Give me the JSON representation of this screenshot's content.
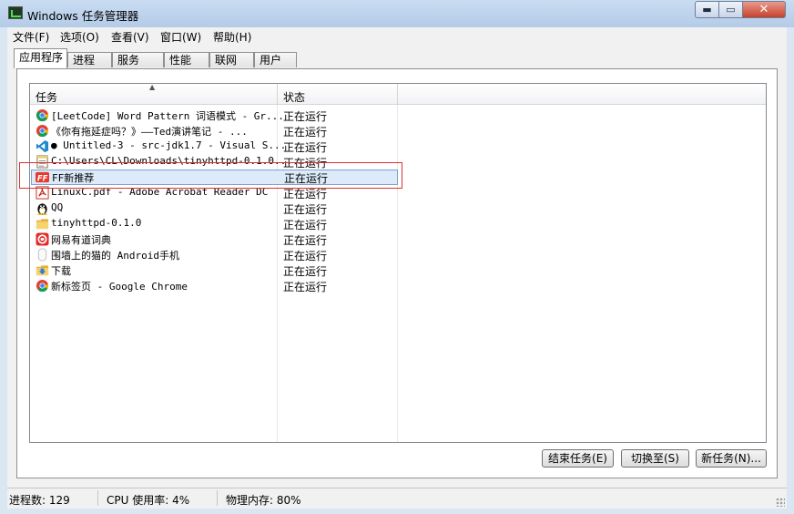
{
  "window": {
    "title": "Windows 任务管理器"
  },
  "menu": [
    "文件(F)",
    "选项(O)",
    "查看(V)",
    "窗口(W)",
    "帮助(H)"
  ],
  "tabs": [
    "应用程序",
    "进程",
    "服务",
    "性能",
    "联网",
    "用户"
  ],
  "table": {
    "columns": [
      "任务",
      "状态"
    ],
    "rows": [
      {
        "task": "[LeetCode] Word Pattern 词语模式 - Gr...",
        "status": "正在运行",
        "icon": "chrome-icon"
      },
      {
        "task": "《你有拖延症吗？》——Ted演讲笔记 - ...",
        "status": "正在运行",
        "icon": "chrome-icon"
      },
      {
        "task": "● Untitled-3 - src-jdk1.7 - Visual S...",
        "status": "正在运行",
        "icon": "vscode-icon"
      },
      {
        "task": "C:\\Users\\CL\\Downloads\\tinyhttpd-0.1.0...",
        "status": "正在运行",
        "icon": "notepad-icon"
      },
      {
        "task": "FF新推荐",
        "status": "正在运行",
        "icon": "ff-icon"
      },
      {
        "task": "LinuxC.pdf - Adobe Acrobat Reader DC",
        "status": "正在运行",
        "icon": "acrobat-icon"
      },
      {
        "task": "QQ",
        "status": "正在运行",
        "icon": "qq-penguin-icon"
      },
      {
        "task": "tinyhttpd-0.1.0",
        "status": "正在运行",
        "icon": "folder-icon"
      },
      {
        "task": "网易有道词典",
        "status": "正在运行",
        "icon": "youdao-icon"
      },
      {
        "task": "围墙上的猫的 Android手机",
        "status": "正在运行",
        "icon": "phone-icon"
      },
      {
        "task": "下载",
        "status": "正在运行",
        "icon": "download-folder-icon"
      },
      {
        "task": "新标签页 - Google Chrome",
        "status": "正在运行",
        "icon": "chrome-icon"
      }
    ],
    "selected_index": 4
  },
  "buttons": {
    "end_task": "结束任务(E)",
    "switch_to": "切换至(S)",
    "new_task": "新任务(N)..."
  },
  "status": {
    "processes": "进程数: 129",
    "cpu": "CPU 使用率: 4%",
    "memory": "物理内存: 80%"
  },
  "colors": {
    "selection_bg": "#dceaf9",
    "highlight_border": "#e03030",
    "titlebar": "#c9dcf2"
  }
}
